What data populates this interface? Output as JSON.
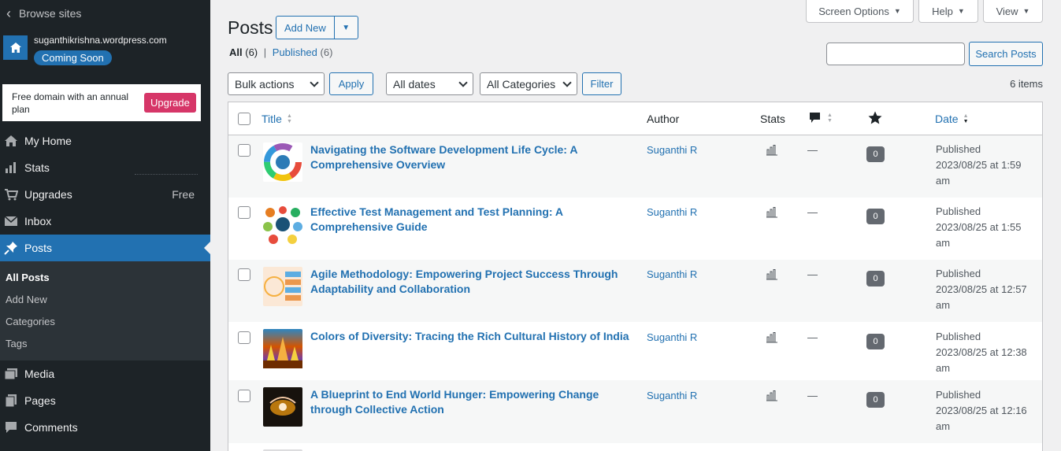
{
  "sidebar": {
    "browse_label": "Browse sites",
    "site_url": "suganthikrishna.wordpress.com",
    "site_badge": "Coming Soon",
    "promo_text": "Free domain with an annual plan",
    "promo_button": "Upgrade",
    "menu": [
      {
        "label": "My Home",
        "icon": "home-icon"
      },
      {
        "label": "Stats",
        "icon": "stats-icon"
      },
      {
        "label": "Upgrades",
        "icon": "cart-icon",
        "extra": "Free"
      },
      {
        "label": "Inbox",
        "icon": "mail-icon"
      },
      {
        "label": "Posts",
        "icon": "pin-icon"
      }
    ],
    "submenu": [
      "All Posts",
      "Add New",
      "Categories",
      "Tags"
    ],
    "menu_after": [
      {
        "label": "Media",
        "icon": "media-icon"
      },
      {
        "label": "Pages",
        "icon": "pages-icon"
      },
      {
        "label": "Comments",
        "icon": "comment-icon"
      }
    ]
  },
  "header": {
    "title": "Posts",
    "add_new": "Add New",
    "screen_options": "Screen Options",
    "help": "Help",
    "view": "View"
  },
  "filters": {
    "all_label": "All",
    "all_count": "(6)",
    "separator": "|",
    "published_label": "Published",
    "published_count": "(6)",
    "search_button": "Search Posts",
    "bulk_actions": "Bulk actions",
    "apply": "Apply",
    "all_dates": "All dates",
    "all_categories": "All Categories",
    "filter": "Filter",
    "items_count": "6 items"
  },
  "table": {
    "columns": {
      "title": "Title",
      "author": "Author",
      "stats": "Stats",
      "date": "Date"
    },
    "rows": [
      {
        "title": "Navigating the Software Development Life Cycle: A Comprehensive Overview",
        "author": "Suganthi R",
        "likes": "0",
        "comments": "—",
        "status": "Published",
        "date": "2023/08/25 at 1:59",
        "ampm": "am"
      },
      {
        "title": "Effective Test Management and Test Planning: A Comprehensive Guide",
        "author": "Suganthi R",
        "likes": "0",
        "comments": "—",
        "status": "Published",
        "date": "2023/08/25 at 1:55",
        "ampm": "am"
      },
      {
        "title": "Agile Methodology: Empowering Project Success Through Adaptability and Collaboration",
        "author": "Suganthi R",
        "likes": "0",
        "comments": "—",
        "status": "Published",
        "date": "2023/08/25 at 12:57",
        "ampm": "am"
      },
      {
        "title": "Colors of Diversity: Tracing the Rich Cultural History of India",
        "author": "Suganthi R",
        "likes": "0",
        "comments": "—",
        "status": "Published",
        "date": "2023/08/25 at 12:38",
        "ampm": "am"
      },
      {
        "title": "A Blueprint to End World Hunger: Empowering Change through Collective Action",
        "author": "Suganthi R",
        "likes": "0",
        "comments": "—",
        "status": "Published",
        "date": "2023/08/25 at 12:16",
        "ampm": "am"
      }
    ]
  }
}
